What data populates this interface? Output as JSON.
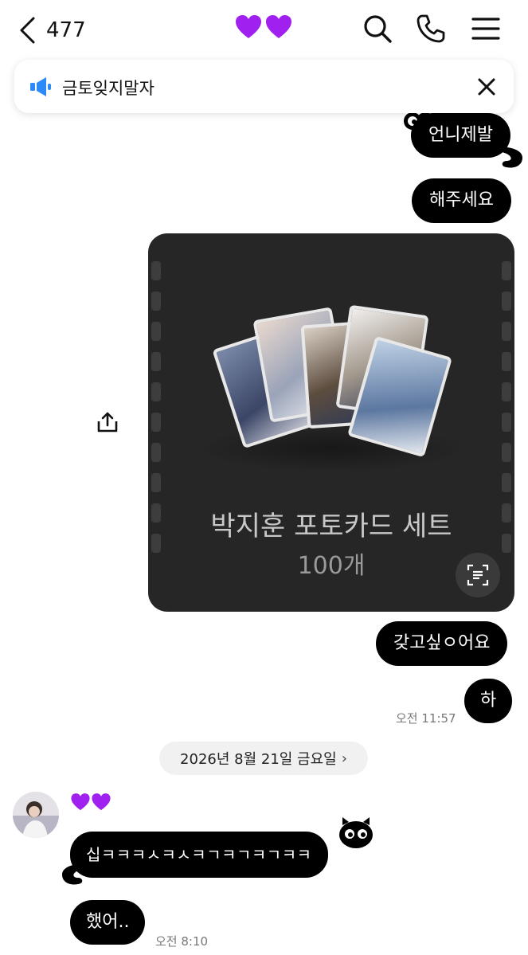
{
  "header": {
    "back_count": "477",
    "title_emoji": "💜💜",
    "search_icon": "search-icon",
    "call_icon": "phone-icon",
    "menu_icon": "menu-icon"
  },
  "notice": {
    "text": "금토잊지말자",
    "icon": "megaphone-icon",
    "close_icon": "close-icon"
  },
  "messages_out": [
    {
      "text": "언니제발"
    },
    {
      "text": "해주세요"
    },
    {
      "text": "갖고싶ㅇ어요"
    },
    {
      "text": "하",
      "time": "오전 11:57"
    }
  ],
  "image_card": {
    "title": "박지훈 포토카드 세트",
    "count": "100개",
    "scan_icon": "text-scan-icon"
  },
  "date_divider": "2026년 8월 21일 금요일",
  "incoming": {
    "sender_name": "💜💜",
    "messages": [
      {
        "text": "십ㅋㅋㅋㅅㅋㅅㅋㄱㅋㄱㅋㄱㅋㅋ"
      },
      {
        "text": "했어..",
        "time": "오전 8:10"
      }
    ]
  },
  "colors": {
    "bubble": "#000000",
    "heart": "#a020f0",
    "accent": "#2b8af7"
  }
}
